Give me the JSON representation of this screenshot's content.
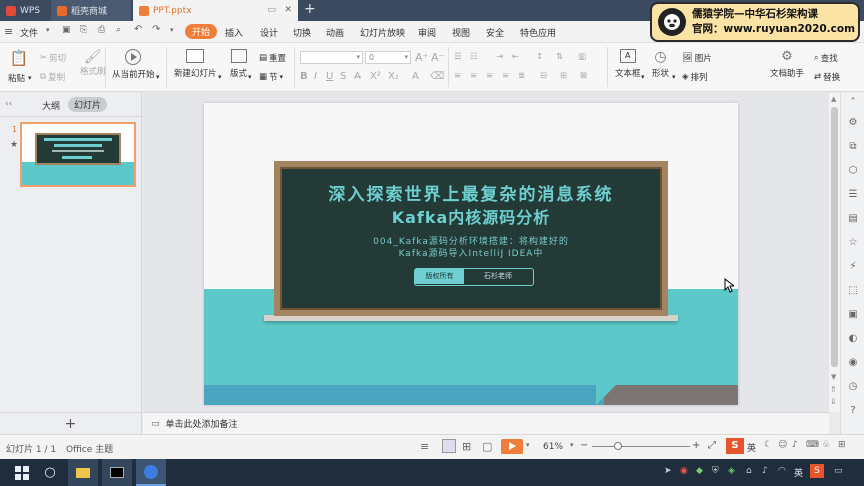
{
  "window": {
    "tabs": [
      {
        "label": "WPS"
      },
      {
        "label": "稻壳商城"
      },
      {
        "label": "PPT.pptx"
      }
    ],
    "new_tab": "+"
  },
  "menu": {
    "file": "文件",
    "items": [
      "开始",
      "插入",
      "设计",
      "切换",
      "动画",
      "幻灯片放映",
      "审阅",
      "视图",
      "安全",
      "特色应用"
    ]
  },
  "ribbon": {
    "paste": "粘贴",
    "cut": "剪切",
    "copy": "复制",
    "format_painter": "格式刷",
    "from_current": "从当前开始",
    "new_slide": "新建幻灯片",
    "layout": "版式",
    "reset": "重置",
    "section": "节",
    "font_size": "0",
    "textbox": "文本框",
    "shape": "形状",
    "picture": "图片",
    "arrange": "排列",
    "doc_assistant": "文档助手",
    "find": "查找",
    "replace": "替换"
  },
  "watermark": {
    "line1": "儒猿学院—中华石杉架构课",
    "line2": "官网：www.ruyuan2020.com"
  },
  "panel": {
    "outline_tab": "大纲",
    "slides_tab": "幻灯片",
    "slide_number": "1",
    "add_slide": "+"
  },
  "slide": {
    "title_line1": "深入探索世界上最复杂的消息系统",
    "title_line2": "Kafka内核源码分析",
    "subtitle_line1": "004_Kafka源码分析环境搭建：将构建好的",
    "subtitle_line2": "Kafka源码导入IntelliJ IDEA中",
    "badge_left": "版权所有",
    "badge_right": "石杉老师"
  },
  "notes": {
    "placeholder": "单击此处添加备注"
  },
  "status": {
    "slide_count": "幻灯片 1 / 1",
    "theme": "Office 主题",
    "zoom": "61%"
  },
  "tray": {
    "ime": "英",
    "lang": "英"
  },
  "colors": {
    "accent": "#f07d3a",
    "chalkboard": "#233a36",
    "teal": "#5cc8c9",
    "title_text": "#6ecfd1"
  }
}
